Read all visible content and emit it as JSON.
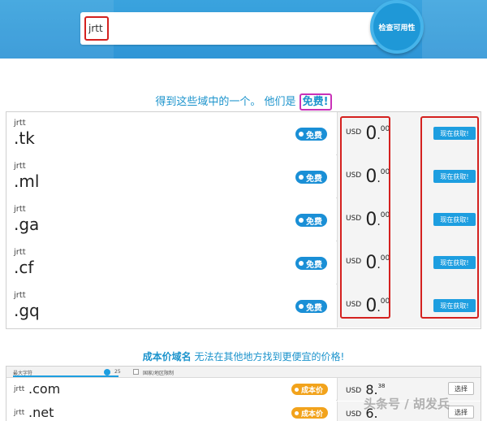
{
  "search": {
    "value": "jrtt",
    "button_label": "检查可用性"
  },
  "headline": {
    "text": "得到这些域中的一个。 他们是",
    "free_word": "免费!"
  },
  "free_domains": [
    {
      "sld": "jrtt",
      "tld": ".tk",
      "badge": "免费",
      "currency": "USD",
      "price_int": "0",
      "price_dec": "00",
      "button": "现在获取!"
    },
    {
      "sld": "jrtt",
      "tld": ".ml",
      "badge": "免费",
      "currency": "USD",
      "price_int": "0",
      "price_dec": "00",
      "button": "现在获取!"
    },
    {
      "sld": "jrtt",
      "tld": ".ga",
      "badge": "免费",
      "currency": "USD",
      "price_int": "0",
      "price_dec": "00",
      "button": "现在获取!"
    },
    {
      "sld": "jrtt",
      "tld": ".cf",
      "badge": "免费",
      "currency": "USD",
      "price_int": "0",
      "price_dec": "00",
      "button": "现在获取!"
    },
    {
      "sld": "jrtt",
      "tld": ".gq",
      "badge": "免费",
      "currency": "USD",
      "price_int": "0",
      "price_dec": "00",
      "button": "现在获取!"
    }
  ],
  "cost": {
    "heading_bold": "成本价域名",
    "heading_rest": " 无法在其他地方找到更便宜的价格!",
    "filter": {
      "max_chars_label": "最大字符",
      "max_chars_value": "25",
      "restrict_label": "国家/地区限制"
    },
    "rows": [
      {
        "sld": "jrtt",
        "tld": ".com",
        "badge": "成本价",
        "currency": "USD",
        "price_int": "8.",
        "price_dec": "38",
        "button": "选择"
      },
      {
        "sld": "jrtt",
        "tld": ".net",
        "badge": "成本价",
        "currency": "USD",
        "price_int": "6.",
        "price_dec": "",
        "button": "选择"
      }
    ]
  },
  "watermark": "头条号 / 胡发兵",
  "colors": {
    "brand_blue": "#1d9ee0",
    "highlight_red": "#d4211f",
    "highlight_magenta": "#c932b8",
    "cost_orange": "#f2a31c"
  }
}
